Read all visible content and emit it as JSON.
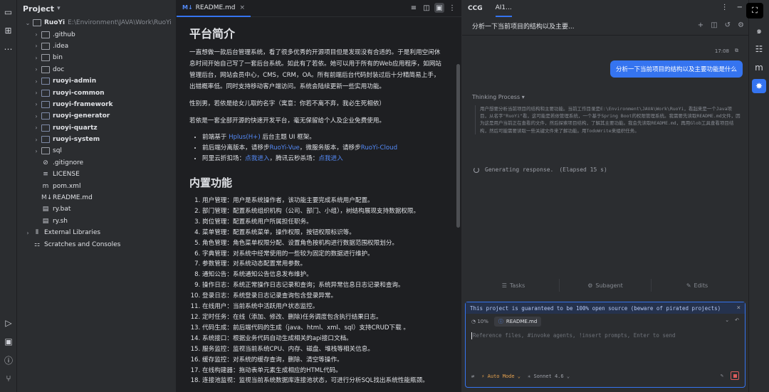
{
  "left_toolbar": {
    "icons": [
      "folder-icon",
      "structure-icon",
      "more-icon"
    ],
    "bottom_icons": [
      "run-icon",
      "terminal-icon",
      "problems-icon",
      "git-icon"
    ]
  },
  "project": {
    "title": "Project",
    "tree": [
      {
        "name": "RuoYi",
        "path": "E:\\Environment\\JAVA\\Work\\RuoYi",
        "level": 0,
        "expanded": true,
        "type": "folder",
        "bold": true
      },
      {
        "name": ".github",
        "level": 1,
        "type": "folder"
      },
      {
        "name": ".idea",
        "level": 1,
        "type": "folder"
      },
      {
        "name": "bin",
        "level": 1,
        "type": "folder"
      },
      {
        "name": "doc",
        "level": 1,
        "type": "folder"
      },
      {
        "name": "ruoyi-admin",
        "level": 1,
        "type": "module",
        "bold": true
      },
      {
        "name": "ruoyi-common",
        "level": 1,
        "type": "module",
        "bold": true
      },
      {
        "name": "ruoyi-framework",
        "level": 1,
        "type": "module",
        "bold": true
      },
      {
        "name": "ruoyi-generator",
        "level": 1,
        "type": "module",
        "bold": true
      },
      {
        "name": "ruoyi-quartz",
        "level": 1,
        "type": "module",
        "bold": true
      },
      {
        "name": "ruoyi-system",
        "level": 1,
        "type": "module",
        "bold": true
      },
      {
        "name": "sql",
        "level": 1,
        "type": "folder"
      },
      {
        "name": ".gitignore",
        "level": 1,
        "type": "file",
        "icon": "⊘"
      },
      {
        "name": "LICENSE",
        "level": 1,
        "type": "file",
        "icon": "≡"
      },
      {
        "name": "pom.xml",
        "level": 1,
        "type": "file",
        "icon": "m"
      },
      {
        "name": "README.md",
        "level": 1,
        "type": "file",
        "icon": "M↓"
      },
      {
        "name": "ry.bat",
        "level": 1,
        "type": "file",
        "icon": "▤"
      },
      {
        "name": "ry.sh",
        "level": 1,
        "type": "file",
        "icon": "▤"
      },
      {
        "name": "External Libraries",
        "level": 0,
        "type": "lib"
      },
      {
        "name": "Scratches and Consoles",
        "level": 0,
        "type": "scratch"
      }
    ]
  },
  "editor": {
    "tab_label": "README.md",
    "h1": "平台简介",
    "p1": "一直想做一款后台管理系统，看了很多优秀的开源项目但是发现没有合适的。于是利用空闲休息时间开始自己写了一套后台系统。如此有了若依。她可以用于所有的Web应用程序，如网站管理后台，网站会员中心，CMS，CRM，OA。所有前端后台代码封装过后十分精简易上手，出错概率低。同时支持移动客户端访问。系统会陆续更新一些实用功能。",
    "p2": "性别男，若依是给女儿取的名字（寓意：你若不离不弃，我必生死相依）",
    "p3": "若依是一套全部开源的快速开发平台，毫无保留给个人及企业免费使用。",
    "bullets": [
      {
        "pre": "前端基于 ",
        "link": "Hplus(H+)",
        "post": " 后台主题 UI 框架。"
      },
      {
        "pre": "前后端分离版本，请移步",
        "link": "RuoYi-Vue",
        "mid": "，微服务版本，请移步",
        "link2": "RuoYi-Cloud"
      },
      {
        "pre": "阿里云折扣场：",
        "link": "点我进入",
        "mid": "，腾讯云秒杀场：",
        "link2": "点我进入"
      }
    ],
    "h2": "内置功能",
    "features": [
      "用户管理：用户是系统操作者，该功能主要完成系统用户配置。",
      "部门管理：配置系统组织机构（公司、部门、小组），树结构展现支持数据权限。",
      "岗位管理：配置系统用户所属担任职务。",
      "菜单管理：配置系统菜单，操作权限，按钮权限标识等。",
      "角色管理：角色菜单权限分配、设置角色按机构进行数据范围权限划分。",
      "字典管理：对系统中经常使用的一些较为固定的数据进行维护。",
      "参数管理：对系统动态配置常用参数。",
      "通知公告：系统通知公告信息发布维护。",
      "操作日志：系统正常操作日志记录和查询；系统异常信息日志记录和查询。",
      "登录日志：系统登录日志记录查询包含登录异常。",
      "在线用户：当前系统中活跃用户状态监控。",
      "定时任务：在线（添加、修改、删除)任务调度包含执行结果日志。",
      "代码生成：前后端代码的生成（java、html、xml、sql）支持CRUD下载 。",
      "系统接口：根据业务代码自动生成相关的api接口文档。",
      "服务监控：监视当前系统CPU、内存、磁盘、堆栈等相关信息。",
      "缓存监控：对系统的缓存查询，删除、清空等操作。",
      "在线构建器：拖动表单元素生成相应的HTML代码。",
      "连接池监视：监视当前系统数据库连接池状态，可进行分析SQL找出系统性能瓶颈。"
    ]
  },
  "ccg": {
    "tabs": [
      "CCG",
      "AI1..."
    ],
    "session_title": "分析一下当前项目的结构以及主要...",
    "time": "17:08",
    "user_message": "分析一下当前项目的结构以及主要功能是什么",
    "thinking_label": "Thinking Process ▾",
    "thinking_text": "用户想要分析当前项目的结构和主要功能。当前工作目录是E:\\Environment\\JAVA\\Work\\RuoYi，看起来是一个Java项目，从名字\"RuoYi\"看，这可能是若依管理系统，一个基于Spring Boot的权限管理系统。我需要先读取README.md文件，因为这是用户当前正在查看的文件，然后探索项目结构，了解其主要功能。我会先读取README.md，再用Glob工具查看项目结构，然后可能需要读取一些关键文件来了解功能。用TodoWrite来组织任务。",
    "generating": "Generating response.",
    "elapsed": "(Elapsed 15 s)",
    "actions": [
      "Tasks",
      "Subagent",
      "Edits"
    ],
    "banner": "This project is guaranteed to be 100% open source (beware of pirated projects)",
    "ctx_percent": "10%",
    "ctx_file": "README.md",
    "placeholder": "Reference files, #invoke agents, !insert prompts, Enter to send",
    "mode": "Auto Mode",
    "model": "Sonnet 4.6"
  },
  "colors": {
    "accent": "#3574f0",
    "bg": "#1e1f22",
    "panel": "#2b2d30"
  }
}
